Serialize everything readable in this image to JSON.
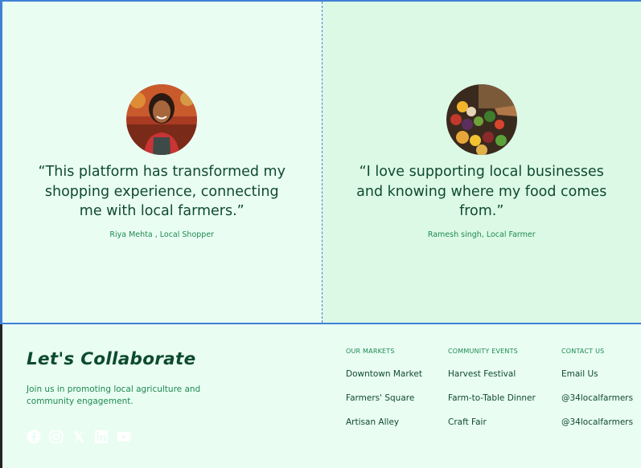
{
  "testimonials": [
    {
      "quote": "“This platform has transformed my shopping experience, connecting me with local farmers.”",
      "author": "Riya Mehta , Local Shopper",
      "avatar_icon": "woman-portrait"
    },
    {
      "quote": "“I love supporting local businesses and knowing where my food comes from.”",
      "author": "Ramesh singh, Local Farmer",
      "avatar_icon": "vegetable-market-portrait"
    }
  ],
  "footer": {
    "brand": "Let's Collaborate",
    "tagline": "Join us in promoting local agriculture and community engagement.",
    "socials": [
      "facebook-icon",
      "instagram-icon",
      "x-icon",
      "linkedin-icon",
      "youtube-icon"
    ],
    "columns": [
      {
        "heading": "OUR MARKETS",
        "links": [
          "Downtown Market",
          "Farmers' Square",
          "Artisan Alley"
        ]
      },
      {
        "heading": "COMMUNITY EVENTS",
        "links": [
          "Harvest Festival",
          "Farm-to-Table Dinner",
          "Craft Fair"
        ]
      },
      {
        "heading": "CONTACT US",
        "links": [
          "Email Us",
          "@34localfarmers",
          "@34localfarmers"
        ]
      }
    ]
  },
  "colors": {
    "accent": "#3f80d6",
    "text_dark": "#0f4a2f",
    "text_green": "#1f8a4f",
    "bg_left": "#e9fdf3",
    "bg_right": "#dcf9e6"
  }
}
